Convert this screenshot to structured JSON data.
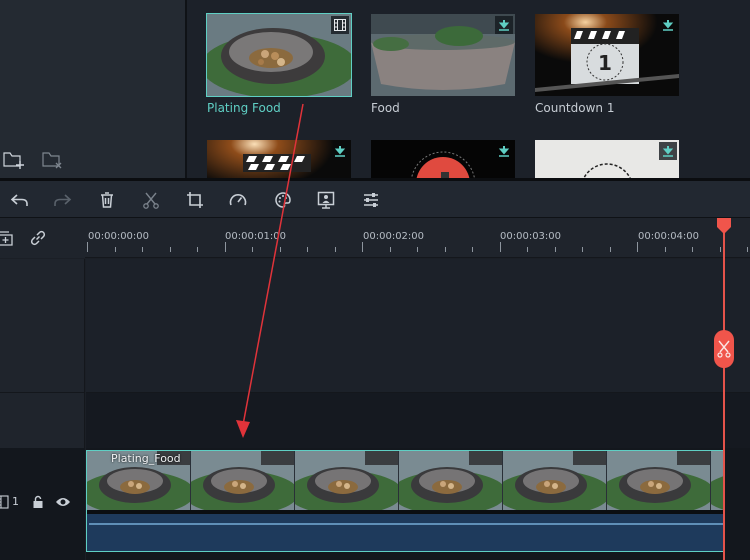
{
  "app": "Video Editor",
  "library": {
    "folder_actions": [
      {
        "icon": "new-folder-icon",
        "label": "New Folder"
      },
      {
        "icon": "delete-folder-icon",
        "label": "Delete Folder"
      }
    ],
    "items": [
      {
        "name": "Plating Food",
        "selected": true,
        "badge": "film-icon",
        "thumb": "bowl-closeup"
      },
      {
        "name": "Food",
        "selected": false,
        "badge": "download-icon",
        "thumb": "bowl-side"
      },
      {
        "name": "Countdown 1",
        "selected": false,
        "badge": "download-icon",
        "thumb": "clapper-1"
      },
      {
        "name": "",
        "selected": false,
        "badge": "download-icon",
        "thumb": "clapper"
      },
      {
        "name": "",
        "selected": false,
        "badge": "download-icon",
        "thumb": "red-countdown"
      },
      {
        "name": "",
        "selected": false,
        "badge": "download-icon",
        "thumb": "white-countdown-3"
      }
    ]
  },
  "toolbar": {
    "tools": [
      {
        "icon": "undo-icon",
        "label": "Undo",
        "enabled": true
      },
      {
        "icon": "redo-icon",
        "label": "Redo",
        "enabled": false
      },
      {
        "icon": "trash-icon",
        "label": "Delete",
        "enabled": true
      },
      {
        "icon": "scissors-icon",
        "label": "Split",
        "enabled": false
      },
      {
        "icon": "crop-icon",
        "label": "Crop",
        "enabled": true
      },
      {
        "icon": "speed-icon",
        "label": "Speed",
        "enabled": true
      },
      {
        "icon": "color-icon",
        "label": "Color",
        "enabled": true
      },
      {
        "icon": "green-screen-icon",
        "label": "Green Screen",
        "enabled": true
      },
      {
        "icon": "adjust-icon",
        "label": "Adjust",
        "enabled": true
      }
    ]
  },
  "timeline": {
    "ruler_actions": [
      {
        "icon": "add-track-icon",
        "label": "Add Track"
      },
      {
        "icon": "link-icon",
        "label": "Link"
      }
    ],
    "timecodes": [
      "00:00:00:00",
      "00:00:01:00",
      "00:00:02:00",
      "00:00:03:00",
      "00:00:04:00"
    ],
    "playhead_time_seconds": 4.62,
    "tracks": [
      {
        "number": "1",
        "type": "video",
        "locked": false,
        "visible": true,
        "clips": [
          {
            "name": "Plating_Food",
            "start_seconds": 0,
            "end_seconds": 4.62
          }
        ]
      }
    ]
  },
  "colors": {
    "accent": "#5fcfc4",
    "playhead": "#f0554b",
    "audio_bar": "#1e3a5c"
  }
}
